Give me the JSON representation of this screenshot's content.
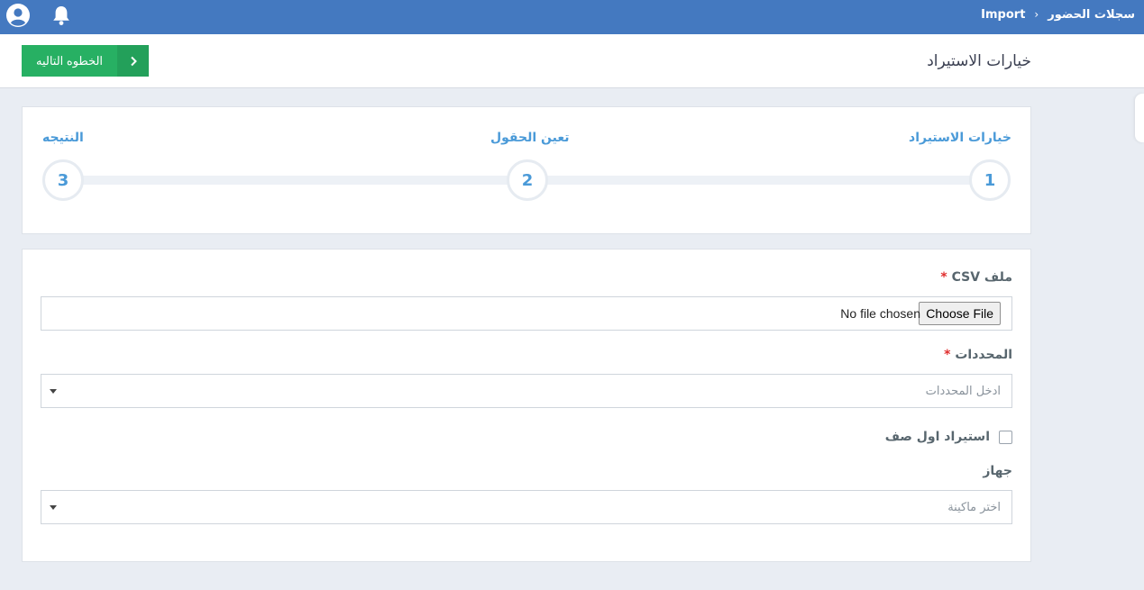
{
  "topbar": {
    "breadcrumb": [
      "سجلات الحضور",
      "Import"
    ],
    "separator": "›"
  },
  "header": {
    "title": "خيارات الاستيراد",
    "next_label": "الخطوه التاليه"
  },
  "stepper": {
    "steps": [
      {
        "number": "1",
        "label": "خيارات الاستيراد"
      },
      {
        "number": "2",
        "label": "تعين الحقول"
      },
      {
        "number": "3",
        "label": "النتيجه"
      }
    ]
  },
  "form": {
    "csv_label": "ملف CSV",
    "required_mark": "*",
    "choose_file": "Choose File",
    "no_file": "No file chosen",
    "delimiters_label": "المحددات",
    "delimiters_placeholder": "ادخل المحددات",
    "first_row_label": "استيراد اول صف",
    "device_label": "جهاز",
    "device_placeholder": "اختر ماكينة"
  },
  "colors": {
    "navbar": "#4479c0",
    "primary_button": "#27b063",
    "step_text": "#4a9ad8",
    "required": "#e02d2d"
  }
}
